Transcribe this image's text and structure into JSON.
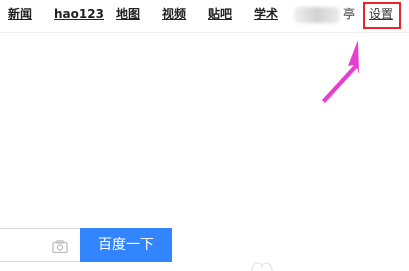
{
  "topnav": {
    "links": [
      {
        "label": "新闻"
      },
      {
        "label": "hao123"
      },
      {
        "label": "地图"
      },
      {
        "label": "视频"
      },
      {
        "label": "贴吧"
      },
      {
        "label": "学术"
      }
    ],
    "partial_text": "亭",
    "settings_label": "设置"
  },
  "search": {
    "button_label": "百度一下",
    "input_value": ""
  },
  "icons": {
    "camera": "camera-icon",
    "arrow": "arrow-annotation"
  },
  "colors": {
    "highlight_border": "#e8262a",
    "arrow": "#e83ecf",
    "search_button": "#3385ff"
  }
}
